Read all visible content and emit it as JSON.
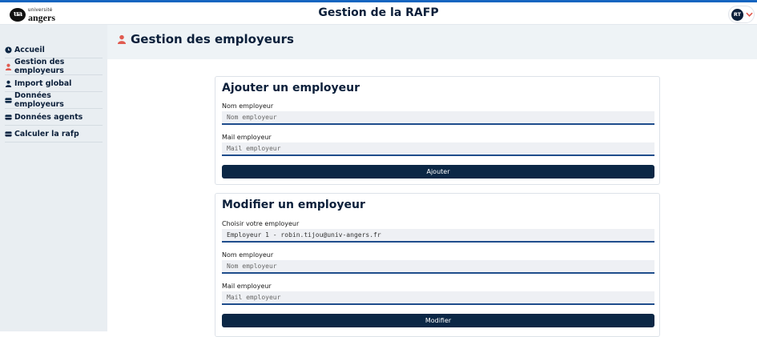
{
  "header": {
    "logo_small": "université",
    "logo_big": "angers",
    "title": "Gestion de la RAFP",
    "user_initials": "RT"
  },
  "sidebar": {
    "items": [
      {
        "label": "Accueil",
        "icon": "clock-icon"
      },
      {
        "label": "Gestion des employeurs",
        "icon": "user-icon"
      },
      {
        "label": "Import global",
        "icon": "user-icon"
      },
      {
        "label": "Données employeurs",
        "icon": "database-icon"
      },
      {
        "label": "Données agents",
        "icon": "database-icon"
      },
      {
        "label": "Calculer la rafp",
        "icon": "database-icon"
      }
    ]
  },
  "page": {
    "title": "Gestion des employeurs"
  },
  "add_card": {
    "title": "Ajouter un employeur",
    "name_label": "Nom employeur",
    "name_placeholder": "Nom employeur",
    "mail_label": "Mail employeur",
    "mail_placeholder": "Mail employeur",
    "submit_label": "Ajouter"
  },
  "edit_card": {
    "title": "Modifier un employeur",
    "select_label": "Choisir votre employeur",
    "select_value": "Employeur 1 - robin.tijou@univ-angers.fr",
    "name_label": "Nom employeur",
    "name_placeholder": "Nom employeur",
    "mail_label": "Mail employeur",
    "mail_placeholder": "Mail employeur",
    "submit_label": "Modifier"
  },
  "colors": {
    "accent": "#1565c0",
    "primary": "#0b2745",
    "user_icon_active": "#e05a4f",
    "sidebar_bg": "#e9eef2"
  }
}
